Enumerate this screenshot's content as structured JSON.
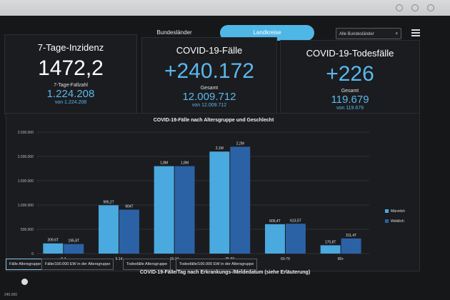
{
  "nav": {
    "tab_bundeslaender": "Bundesländer",
    "tab_landkreise": "Landkreise",
    "region_select": "Alle Bundesländer"
  },
  "cards": {
    "inzidenz": {
      "title": "7-Tage-Inzidenz",
      "value": "1472,2",
      "sub_label": "7-Tage-Fallzahl",
      "sub_value": "1.224.208",
      "sub_note": "von 1.224.208"
    },
    "faelle": {
      "title": "COVID-19-Fälle",
      "value": "+240.172",
      "sub_label": "Gesamt",
      "sub_value": "12.009.712",
      "sub_note": "von 12.009.712"
    },
    "todesfaelle": {
      "title": "COVID-19-Todesfälle",
      "value": "+226",
      "sub_label": "Gesamt",
      "sub_value": "119.679",
      "sub_note": "von 119.679"
    }
  },
  "colors": {
    "accent": "#4fb7e6",
    "maennlich": "#4aa9de",
    "weiblich": "#2b62a6"
  },
  "chart_data": {
    "type": "bar",
    "title": "COVID-19-Fälle nach Altersgruppe und Geschlecht",
    "categories": [
      "0-4",
      "5-14",
      "15-34",
      "35-59",
      "60-79",
      "80+"
    ],
    "series": [
      {
        "name": "Männlich",
        "values": [
          209600,
          995270,
          1800000,
          2100000,
          605410,
          170870
        ],
        "labels": [
          "209,6T",
          "995,27",
          "1,8M",
          "2,1M",
          "605,4T",
          "170,8T"
        ]
      },
      {
        "name": "Weiblich",
        "values": [
          195870,
          904700,
          1800000,
          2200000,
          613570,
          311470
        ],
        "labels": [
          "195,8T",
          "904T",
          "1,8M",
          "2,2M",
          "613,5T",
          "311,4T"
        ]
      }
    ],
    "yticks": [
      "0",
      "500.000",
      "1.000.000",
      "1.500.000",
      "2.000.000",
      "2.500.000"
    ],
    "ylim": [
      0,
      2500000
    ],
    "legend_position": "right",
    "grid": true
  },
  "chart_tabs": [
    "Fälle Altersgruppe",
    "Fälle/100.000 EW in der Altersgruppe",
    "Todesfälle Altersgruppe",
    "Todesfälle/100.000 EW in der Altersgruppe"
  ],
  "bottom": {
    "title": "COVID-19-Fälle/Tag nach Erkrankungs-/Meldedatum (siehe Erläuterung)",
    "tick": "240.000"
  }
}
